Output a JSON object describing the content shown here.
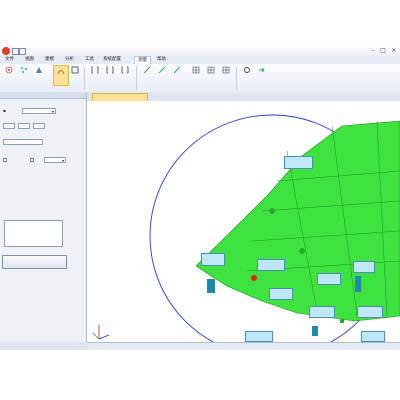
{
  "window": {
    "title": ""
  },
  "menu": {
    "items": [
      "文件",
      "视图",
      "建模",
      "分析",
      "工具",
      "系统配置",
      "测量",
      "帮助"
    ],
    "active_index": 6
  },
  "ribbon": {
    "buttons": [
      {
        "label": "",
        "icon": "target-icon"
      },
      {
        "label": "",
        "icon": "points-icon"
      },
      {
        "label": "",
        "icon": "probe-icon"
      },
      {
        "label": "",
        "icon": "curve-icon",
        "active": true
      },
      {
        "label": "",
        "icon": "frame-icon"
      },
      {
        "label": "",
        "icon": "bracket-icon"
      },
      {
        "label": "",
        "icon": "bracket-icon"
      },
      {
        "label": "",
        "icon": "bracket-icon"
      },
      {
        "label": "",
        "icon": "line-icon"
      },
      {
        "label": "",
        "icon": "line-icon"
      },
      {
        "label": "",
        "icon": "line-icon"
      },
      {
        "label": "",
        "icon": "grid-icon"
      },
      {
        "label": "",
        "icon": "grid-icon"
      },
      {
        "label": "",
        "icon": "grid-icon"
      },
      {
        "label": "",
        "icon": "settings-icon"
      },
      {
        "label": "",
        "icon": "export-icon"
      }
    ],
    "groups": [
      "",
      "",
      "",
      ""
    ]
  },
  "panel": {
    "title": "",
    "section1": "",
    "field1_value": "",
    "section2": "",
    "section3": "",
    "field3_value": "",
    "section4": "",
    "tree_nodes": [
      "",
      "",
      ""
    ],
    "finish_label": "",
    "bottom_tabs": [
      "",
      "",
      ""
    ]
  },
  "viewport": {
    "tab_label": "",
    "axes_label": "",
    "status_items": [
      "",
      "",
      ""
    ]
  },
  "annotations": [
    {
      "lines": [
        "",
        "",
        "",
        ""
      ]
    },
    {
      "lines": [
        "",
        "",
        "",
        ""
      ]
    },
    {
      "lines": [
        "",
        "",
        "",
        ""
      ]
    },
    {
      "lines": [
        "",
        "",
        "",
        ""
      ]
    },
    {
      "lines": [
        "",
        "",
        "",
        ""
      ]
    },
    {
      "lines": [
        "",
        "",
        "",
        ""
      ]
    },
    {
      "lines": [
        "",
        "",
        "",
        ""
      ]
    },
    {
      "lines": [
        "",
        "",
        "",
        ""
      ]
    },
    {
      "lines": [
        "",
        "",
        "",
        ""
      ]
    },
    {
      "lines": [
        "",
        "",
        "",
        ""
      ]
    }
  ],
  "colors": {
    "model_green": "#3fe33f",
    "model_dark": "#2faa2f",
    "circle_blue": "#1f3fd0",
    "annotation_fill": "#bfe8f7",
    "active_tab": "#fbe39a",
    "marker_red": "#e0201a"
  }
}
